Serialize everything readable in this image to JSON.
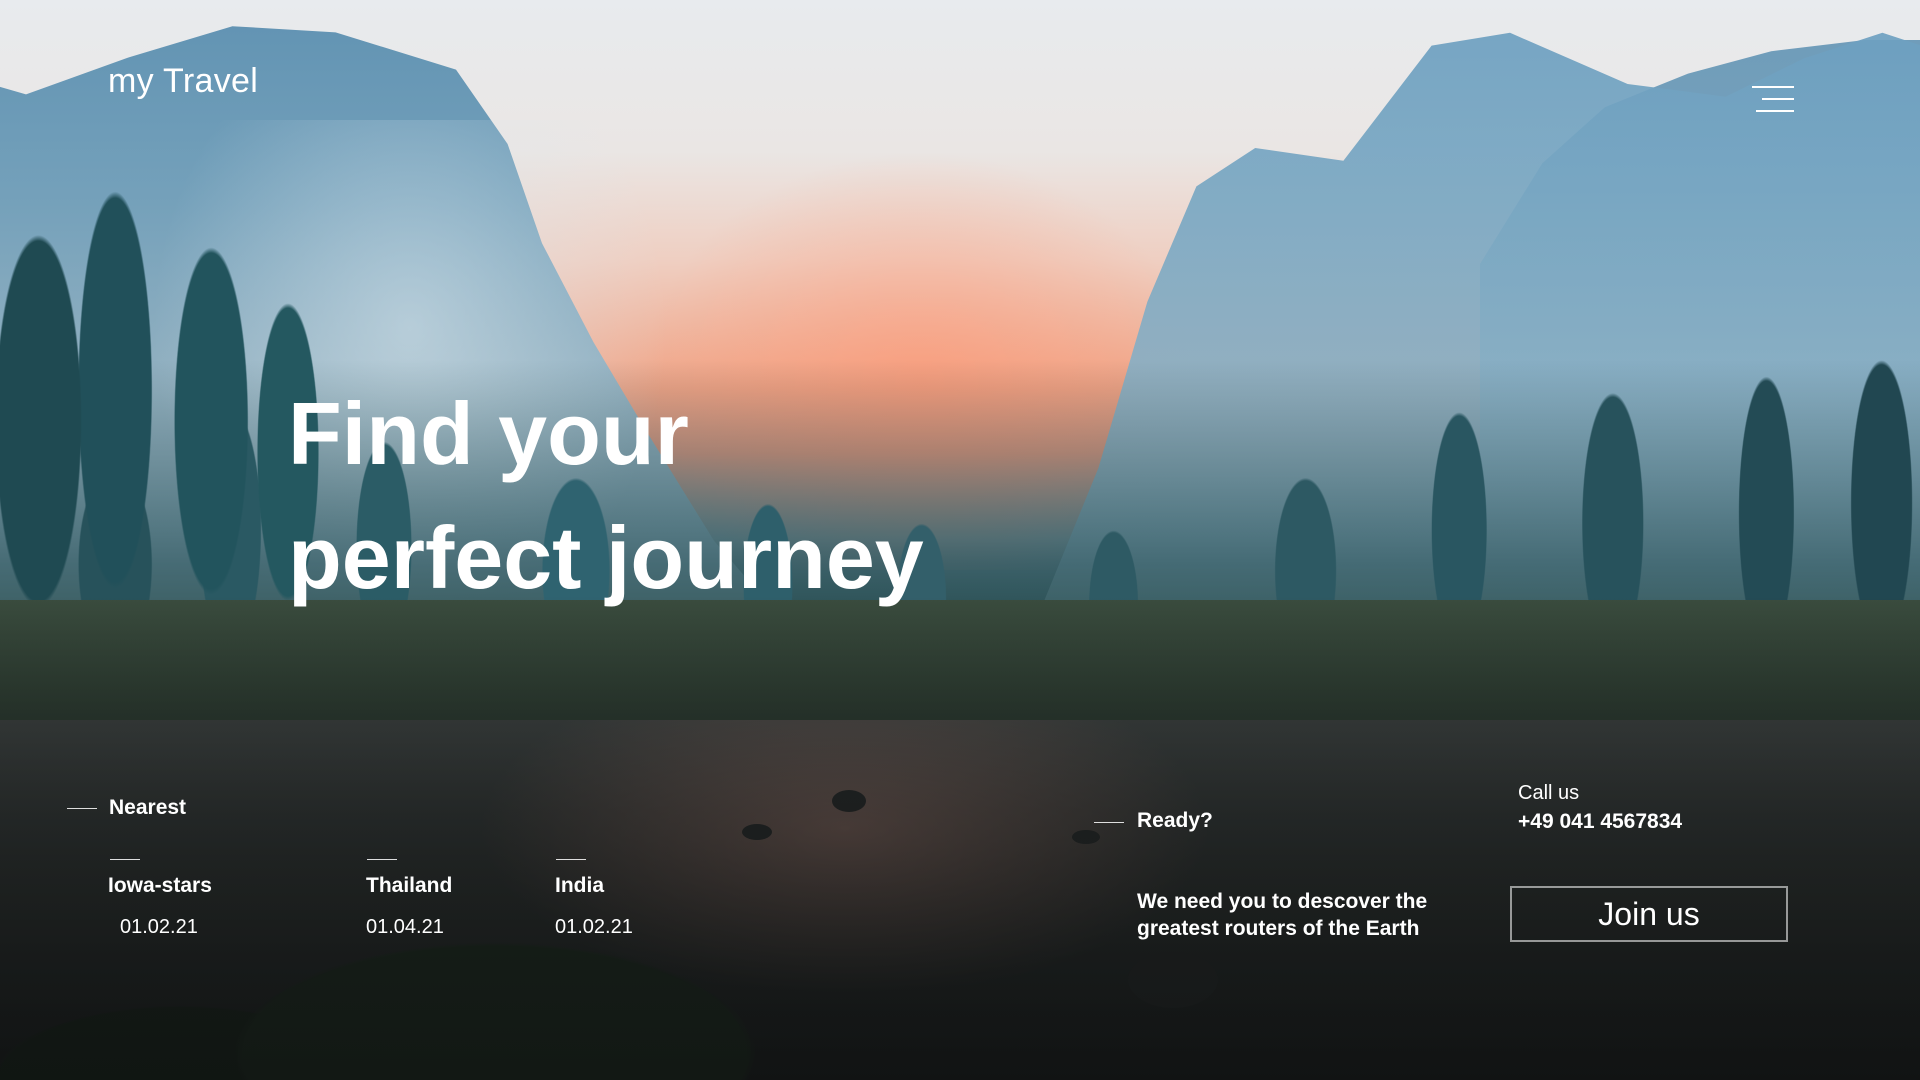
{
  "header": {
    "logo": "my Travel",
    "menu_icon": "hamburger-menu-icon"
  },
  "hero": {
    "line1": "Find your",
    "line2": "perfect journey"
  },
  "nearest": {
    "title": "Nearest",
    "destinations": [
      {
        "name": "Iowa-stars",
        "date": "01.02.21"
      },
      {
        "name": "Thailand",
        "date": "01.04.21"
      },
      {
        "name": "India",
        "date": "01.02.21"
      }
    ]
  },
  "ready": {
    "title": "Ready?",
    "text_line1": "We need you to descover the",
    "text_line2": "greatest routers of the Earth"
  },
  "contact": {
    "label": "Call us",
    "phone": "+49 041 4567834"
  },
  "cta": {
    "join_label": "Join us"
  },
  "colors": {
    "text": "#ffffff",
    "sky_glow": "#f0a486",
    "mountain_blue": "#6f9eb9",
    "forest_teal": "#2a5963"
  }
}
